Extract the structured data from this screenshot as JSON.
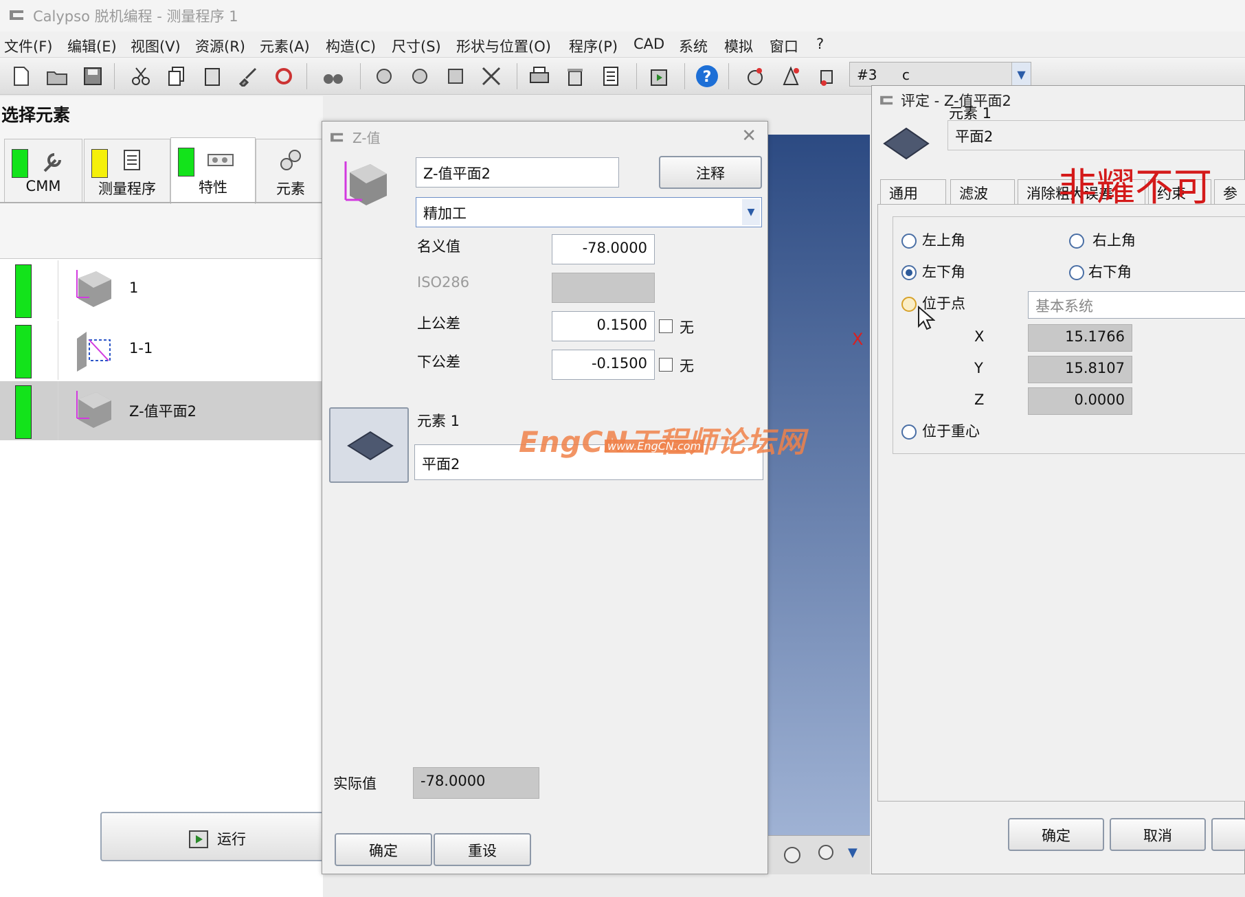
{
  "window": {
    "title": "Calypso 脱机编程 - 测量程序 1"
  },
  "menu": [
    "文件(F)",
    "编辑(E)",
    "视图(V)",
    "资源(R)",
    "元素(A)",
    "构造(C)",
    "尺寸(S)",
    "形状与位置(O)",
    "程序(P)",
    "CAD",
    "系统",
    "模拟",
    "窗口",
    "?"
  ],
  "toolbar": {
    "combo_value1": "#3",
    "combo_value2": "c"
  },
  "left_panel": {
    "title": "选择元素",
    "tabs": [
      {
        "label": "CMM",
        "status": "#13e31b"
      },
      {
        "label": "测量程序",
        "status": "#f5f00a"
      },
      {
        "label": "特性",
        "status": "#13e31b"
      },
      {
        "label": "元素"
      }
    ],
    "items": [
      {
        "label": "1",
        "status": "#13e31b"
      },
      {
        "label": "1-1",
        "status": "#13e31b"
      },
      {
        "label": "Z-值平面2",
        "status": "#13e31b",
        "selected": true
      }
    ],
    "run_label": "运行"
  },
  "z_dialog": {
    "title": "Z-值",
    "name_value": "Z-值平面2",
    "comment_label": "注释",
    "process_value": "精加工",
    "nominal_label": "名义值",
    "nominal_value": "-78.0000",
    "iso_label": "ISO286",
    "upper_label": "上公差",
    "upper_value": "0.1500",
    "upper_none": "无",
    "lower_label": "下公差",
    "lower_value": "-0.1500",
    "lower_none": "无",
    "element_label": "元素 1",
    "element_value": "平面2",
    "actual_label": "实际值",
    "actual_value": "-78.0000",
    "ok_label": "确定",
    "reset_label": "重设"
  },
  "eval_dialog": {
    "title": "评定 - Z-值平面2",
    "element_label": "元素 1",
    "element_value": "平面2",
    "tabs": [
      "通用",
      "滤波",
      "消除粗大误差",
      "约束",
      "参"
    ],
    "options": {
      "top_left": "左上角",
      "top_right": "右上角",
      "bottom_left": "左下角",
      "bottom_right": "右下角",
      "at_point": "位于点",
      "at_center": "位于重心",
      "selected": "bottom_left"
    },
    "coord_system": "基本系统",
    "x_label": "X",
    "x_value": "15.1766",
    "y_label": "Y",
    "y_value": "15.8107",
    "z_label": "Z",
    "z_value": "0.0000",
    "ok_label": "确定",
    "cancel_label": "取消"
  },
  "overlays": {
    "watermark_main": "EngCN工程师论坛网",
    "watermark_url": "www.EngCN.com",
    "red_caption": "非耀不可"
  }
}
